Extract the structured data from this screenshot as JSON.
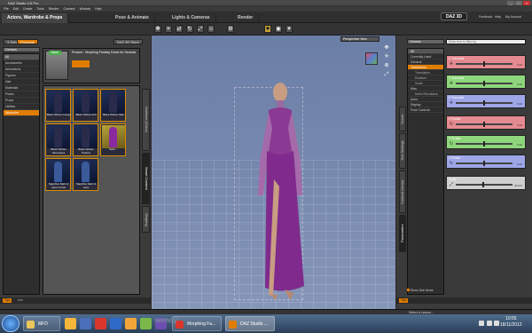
{
  "app": {
    "title": "DAZ Studio 4.5 Pro"
  },
  "menu": [
    "File",
    "Edit",
    "Create",
    "Tools",
    "Render",
    "Connect",
    "Window",
    "Help"
  ],
  "tabs": [
    "Actors, Wardrobe & Props",
    "Pose & Animate",
    "Lights & Cameras",
    "Render"
  ],
  "brand": {
    "logo": "DAZ 3D",
    "links": [
      "Feedback",
      "Help",
      "My Account"
    ]
  },
  "left": {
    "subtabs": [
      "3 Sets",
      "Products"
    ],
    "store_btn": "DAZ 3D Store",
    "dropdown": "Genesis",
    "categories": [
      "All",
      "Accessories",
      "Animations",
      "Figures",
      "Hair",
      "Materials",
      "Poses",
      "Props",
      "Utilities",
      "Wardrobe"
    ],
    "product_button": "Back",
    "product_title": "Product - Morphing Fantasy Dress for Genesis",
    "thumbs": [
      {
        "label": "Black Widow Corset"
      },
      {
        "label": "Black Widow Full"
      },
      {
        "label": "Black Widow Skirt"
      },
      {
        "label": "Black Widow Sleeveless"
      },
      {
        "label": "Black Widow Topless"
      },
      {
        "label": "Sash ..."
      },
      {
        "label": "Sapphire Satin & Lace Corset"
      },
      {
        "label": "Sapphire Satin & Lace"
      }
    ],
    "side_tabs": [
      "Surfaces (Color)",
      "Smart Content",
      "Shaping"
    ],
    "tips": [
      "Tips",
      "Info"
    ]
  },
  "viewport": {
    "camera": "Perspective View"
  },
  "right": {
    "search_placeholder": "Enter text to filter by",
    "dropdown": "Genesis",
    "list": [
      "All",
      "Currently Used",
      "General",
      "Transforms",
      "Translation",
      "Rotation",
      "Scale",
      "Misc",
      "Mesh Resolution",
      "Actor",
      "Display",
      "Pose Controls"
    ],
    "params": [
      {
        "name": "X Translate",
        "value": "0.00",
        "color": "#e58a90"
      },
      {
        "name": "Y Translate",
        "value": "0.00",
        "color": "#8ed67c"
      },
      {
        "name": "Z Translate",
        "value": "0.00",
        "color": "#9ea6e8"
      },
      {
        "name": "X Rotate",
        "value": "0.00",
        "color": "#e58a90"
      },
      {
        "name": "Y Rotate",
        "value": "0.00",
        "color": "#8ed67c"
      },
      {
        "name": "Z Rotate",
        "value": "0.00",
        "color": "#9ea6e8"
      },
      {
        "name": "Scale",
        "value": "96.0%",
        "color": "#cfcfcf"
      }
    ],
    "side_tabs": [
      "Scene",
      "Tool Settings",
      "Content Library",
      "Parameters"
    ],
    "show_sub": "Show Sub Items",
    "tips": [
      "Tips"
    ]
  },
  "status": {
    "lesson": "Select a Lesson..."
  },
  "taskbar": {
    "items": [
      "MFD",
      "Morphing Fa...",
      "DAZ Studio ..."
    ],
    "time": "10:55",
    "date": "18/11/2012"
  },
  "watermark": "wendy"
}
